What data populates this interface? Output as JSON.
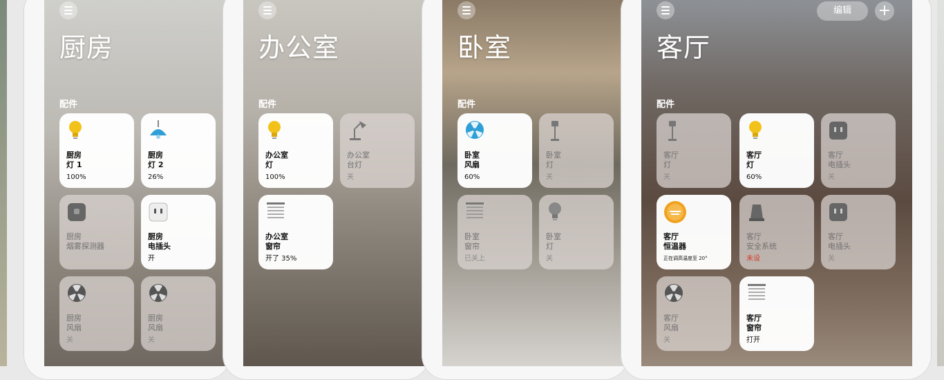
{
  "screens": [
    {
      "title": "厨房",
      "section_label": "配件",
      "tiles": [
        {
          "line1": "厨房",
          "line2": "灯 1",
          "status": "100%",
          "icon": "bulb-icon",
          "on": true
        },
        {
          "line1": "厨房",
          "line2": "灯 2",
          "status": "26%",
          "icon": "pendant-lamp-icon",
          "on": true
        },
        {
          "line1": "厨房",
          "line2": "烟雾探测器",
          "status": "",
          "icon": "smoke-detector-icon",
          "on": false
        },
        {
          "line1": "厨房",
          "line2": "电插头",
          "status": "开",
          "icon": "outlet-icon",
          "on": true
        },
        {
          "line1": "厨房",
          "line2": "风扇",
          "status": "关",
          "icon": "fan-icon",
          "on": false
        },
        {
          "line1": "厨房",
          "line2": "风扇",
          "status": "关",
          "icon": "fan-icon",
          "on": false
        }
      ]
    },
    {
      "title": "办公室",
      "section_label": "配件",
      "tiles": [
        {
          "line1": "办公室",
          "line2": "灯",
          "status": "100%",
          "icon": "bulb-icon",
          "on": true
        },
        {
          "line1": "办公室",
          "line2": "台灯",
          "status": "关",
          "icon": "desk-lamp-icon",
          "on": false
        },
        {
          "line1": "办公室",
          "line2": "窗帘",
          "status": "开了 35%",
          "icon": "blinds-icon",
          "on": true
        }
      ]
    },
    {
      "title": "卧室",
      "section_label": "配件",
      "tiles": [
        {
          "line1": "卧室",
          "line2": "风扇",
          "status": "60%",
          "icon": "fan-icon",
          "on": true
        },
        {
          "line1": "卧室",
          "line2": "灯",
          "status": "关",
          "icon": "floor-lamp-icon",
          "on": false
        },
        {
          "line1": "卧室",
          "line2": "窗帘",
          "status": "已关上",
          "icon": "blinds-icon",
          "on": false
        },
        {
          "line1": "卧室",
          "line2": "灯",
          "status": "关",
          "icon": "bulb-icon",
          "on": false
        }
      ]
    },
    {
      "title": "客厅",
      "section_label": "配件",
      "edit_label": "编辑",
      "add_label": "+",
      "tiles": [
        {
          "line1": "客厅",
          "line2": "灯",
          "status": "关",
          "icon": "floor-lamp-icon",
          "on": false
        },
        {
          "line1": "客厅",
          "line2": "灯",
          "status": "60%",
          "icon": "bulb-icon",
          "on": true
        },
        {
          "line1": "客厅",
          "line2": "电插头",
          "status": "关",
          "icon": "outlet-icon",
          "on": false
        },
        {
          "line1": "客厅",
          "line2": "恒温器",
          "status": "正在调高温度至 20°",
          "icon": "thermostat-icon",
          "on": true
        },
        {
          "line1": "客厅",
          "line2": "安全系统",
          "status": "未设",
          "icon": "security-system-icon",
          "on": false,
          "alert": true
        },
        {
          "line1": "客厅",
          "line2": "电插头",
          "status": "关",
          "icon": "outlet-icon",
          "on": false
        },
        {
          "line1": "客厅",
          "line2": "风扇",
          "status": "关",
          "icon": "fan-icon",
          "on": false
        },
        {
          "line1": "客厅",
          "line2": "窗帘",
          "status": "打开",
          "icon": "blinds-icon",
          "on": true
        }
      ]
    }
  ],
  "colors": {
    "bulb": "#f2c21a",
    "pendant": "#2f9fd6",
    "fan_on": "#2f9fd6",
    "thermostat": "#f0a21e",
    "alert": "#d23a2a"
  }
}
